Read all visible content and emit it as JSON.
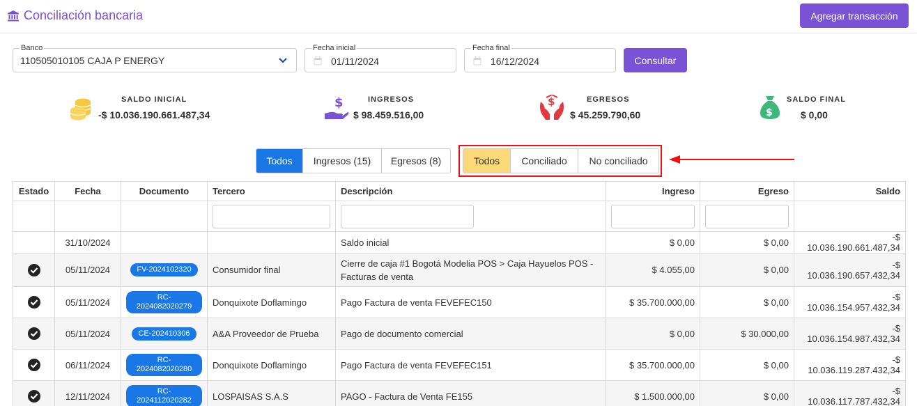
{
  "header": {
    "title": "Conciliación bancaria",
    "add_button": "Agregar transacción"
  },
  "filters": {
    "bank_label": "Banco",
    "bank_value": "110505010105 CAJA P ENERGY",
    "start_label": "Fecha inicial",
    "start_value": "01/11/2024",
    "end_label": "Fecha final",
    "end_value": "16/12/2024",
    "consult_button": "Consultar"
  },
  "summary": [
    {
      "label": "SALDO INICIAL",
      "value": "-$ 10.036.190.661.487,34",
      "icon": "coins-icon",
      "color": "#f5c842"
    },
    {
      "label": "INGRESOS",
      "value": "$ 98.459.516,00",
      "icon": "hand-dollar-icon",
      "color": "#7952d6"
    },
    {
      "label": "EGRESOS",
      "value": "$ 45.259.790,60",
      "icon": "hands-dollar-icon",
      "color": "#e0393e"
    },
    {
      "label": "SALDO FINAL",
      "value": "$ 0,00",
      "icon": "money-bag-icon",
      "color": "#3fb67a"
    }
  ],
  "type_tabs": [
    "Todos",
    "Ingresos (15)",
    "Egresos (8)"
  ],
  "status_tabs": [
    "Todos",
    "Conciliado",
    "No conciliado"
  ],
  "table": {
    "columns": [
      "Estado",
      "Fecha",
      "Documento",
      "Tercero",
      "Descripción",
      "Ingreso",
      "Egreso",
      "Saldo"
    ],
    "rows": [
      {
        "estado": "",
        "fecha": "31/10/2024",
        "documento": "",
        "tercero": "",
        "descripcion": "Saldo inicial",
        "ingreso": "$ 0,00",
        "egreso": "$ 0,00",
        "saldo": "-$ 10.036.190.661.487,34"
      },
      {
        "estado": "check",
        "fecha": "05/11/2024",
        "documento": "FV-2024102320",
        "tercero": "Consumidor final",
        "descripcion": "Cierre de caja #1 Bogotá Modelia POS > Caja Hayuelos POS - Facturas de venta",
        "ingreso": "$ 4.055,00",
        "egreso": "$ 0,00",
        "saldo": "-$ 10.036.190.657.432,34"
      },
      {
        "estado": "check",
        "fecha": "05/11/2024",
        "documento": "RC-2024082020279",
        "tercero": "Donquixote Doflamingo",
        "descripcion": "Pago Factura de venta FEVEFEC150",
        "ingreso": "$ 35.700.000,00",
        "egreso": "$ 0,00",
        "saldo": "-$ 10.036.154.957.432,34"
      },
      {
        "estado": "check",
        "fecha": "05/11/2024",
        "documento": "CE-202410306",
        "tercero": "A&A Proveedor de Prueba",
        "descripcion": "Pago de documento comercial",
        "ingreso": "$ 0,00",
        "egreso": "$ 30.000,00",
        "saldo": "-$ 10.036.154.987.432,34"
      },
      {
        "estado": "check",
        "fecha": "06/11/2024",
        "documento": "RC-2024082020280",
        "tercero": "Donquixote Doflamingo",
        "descripcion": "Pago Factura de venta FEVEFEC151",
        "ingreso": "$ 35.700.000,00",
        "egreso": "$ 0,00",
        "saldo": "-$ 10.036.119.287.432,34"
      },
      {
        "estado": "check",
        "fecha": "12/11/2024",
        "documento": "RC-2024112020282",
        "tercero": "LOSPAISAS S.A.S",
        "descripcion": "PAGO - Factura de Venta FE155",
        "ingreso": "$ 1.500.000,00",
        "egreso": "$ 0,00",
        "saldo": "-$ 10.036.117.787.432,34"
      }
    ]
  },
  "colors": {
    "accent": "#7952d6",
    "blue": "#1a78e6",
    "highlight": "#fcd978",
    "annotation": "#e11111"
  }
}
